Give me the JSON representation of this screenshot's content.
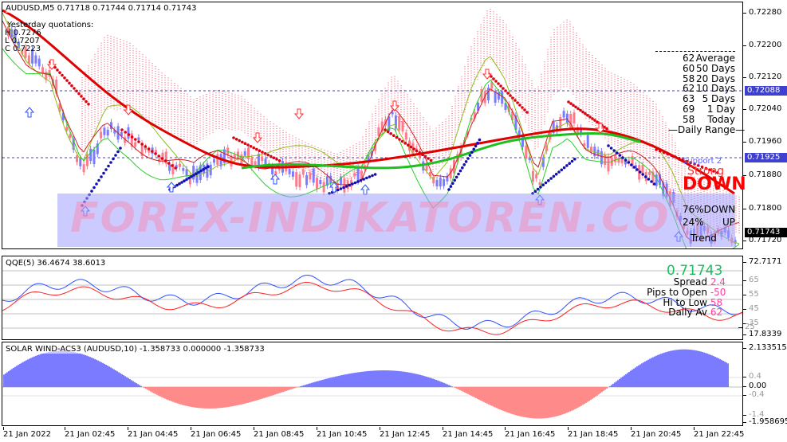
{
  "main": {
    "title": "AUDUSD,M5  0.71718 0.71744 0.71714 0.71743",
    "yesterday": {
      "heading": "Yesterday quotations:",
      "high": "H 0.7276",
      "low": "L 0.7207",
      "close": "C 0.7223"
    },
    "price_ticks": [
      "0.72280",
      "0.72200",
      "0.72120",
      "0.72040",
      "0.71960",
      "0.71880",
      "0.71800",
      "0.71720"
    ],
    "tags": {
      "level_upper": "0.72088",
      "level_support": "0.71925",
      "last_price": "0.71743"
    },
    "ranges": [
      {
        "n": "62",
        "label": "Average"
      },
      {
        "n": "60",
        "label": "50 Days"
      },
      {
        "n": "58",
        "label": "20 Days"
      },
      {
        "n": "62",
        "label": "10 Days"
      },
      {
        "n": "63",
        "label": "5 Days"
      },
      {
        "n": "69",
        "label": "1 Day"
      },
      {
        "n": "58",
        "label": "Today"
      }
    ],
    "daily_range_label": "Daily Range",
    "support_label": "Support 2",
    "strong_label": "Strong",
    "down_label": "DOWN",
    "pct_down": "76%DOWN",
    "pct_up": "24%",
    "up_label": "UP",
    "trend_label": "Trend",
    "watermark": "FOREX-INDIKATOREN.CO",
    "colors": {
      "up_candle": "#7b7bff",
      "down_candle": "#ff7b8c",
      "red_ma": "#e00000",
      "green_ma": "#1fbf1f",
      "cloud": "#e0002a",
      "dots_blue": "#1010b0",
      "dots_red": "#e00010"
    }
  },
  "qqe": {
    "title": "QQE(5) 36.4674 38.6013",
    "ticks": [
      "72.7171",
      "65",
      "55",
      "45",
      "35",
      "25",
      "17.8339"
    ],
    "price": "0.71743",
    "stats": [
      {
        "label": "Spread",
        "value": "2.4"
      },
      {
        "label": "Pips to Open",
        "value": "-50"
      },
      {
        "label": "Hi to Low",
        "value": "58"
      },
      {
        "label": "Daily Av",
        "value": "62"
      }
    ]
  },
  "solar": {
    "title": "SOLAR WIND-ACS3 (AUDUSD,10) -1.358733 0.000000 -1.358733",
    "ticks": [
      "2.133515",
      "0.4",
      "0.00",
      "-0.4",
      "-1.4",
      "-1.958695"
    ]
  },
  "time_labels": [
    "21 Jan 2022",
    "21 Jan 02:45",
    "21 Jan 04:45",
    "21 Jan 06:45",
    "21 Jan 08:45",
    "21 Jan 10:45",
    "21 Jan 12:45",
    "21 Jan 14:45",
    "21 Jan 16:45",
    "21 Jan 18:45",
    "21 Jan 20:45",
    "21 Jan 22:45"
  ]
}
